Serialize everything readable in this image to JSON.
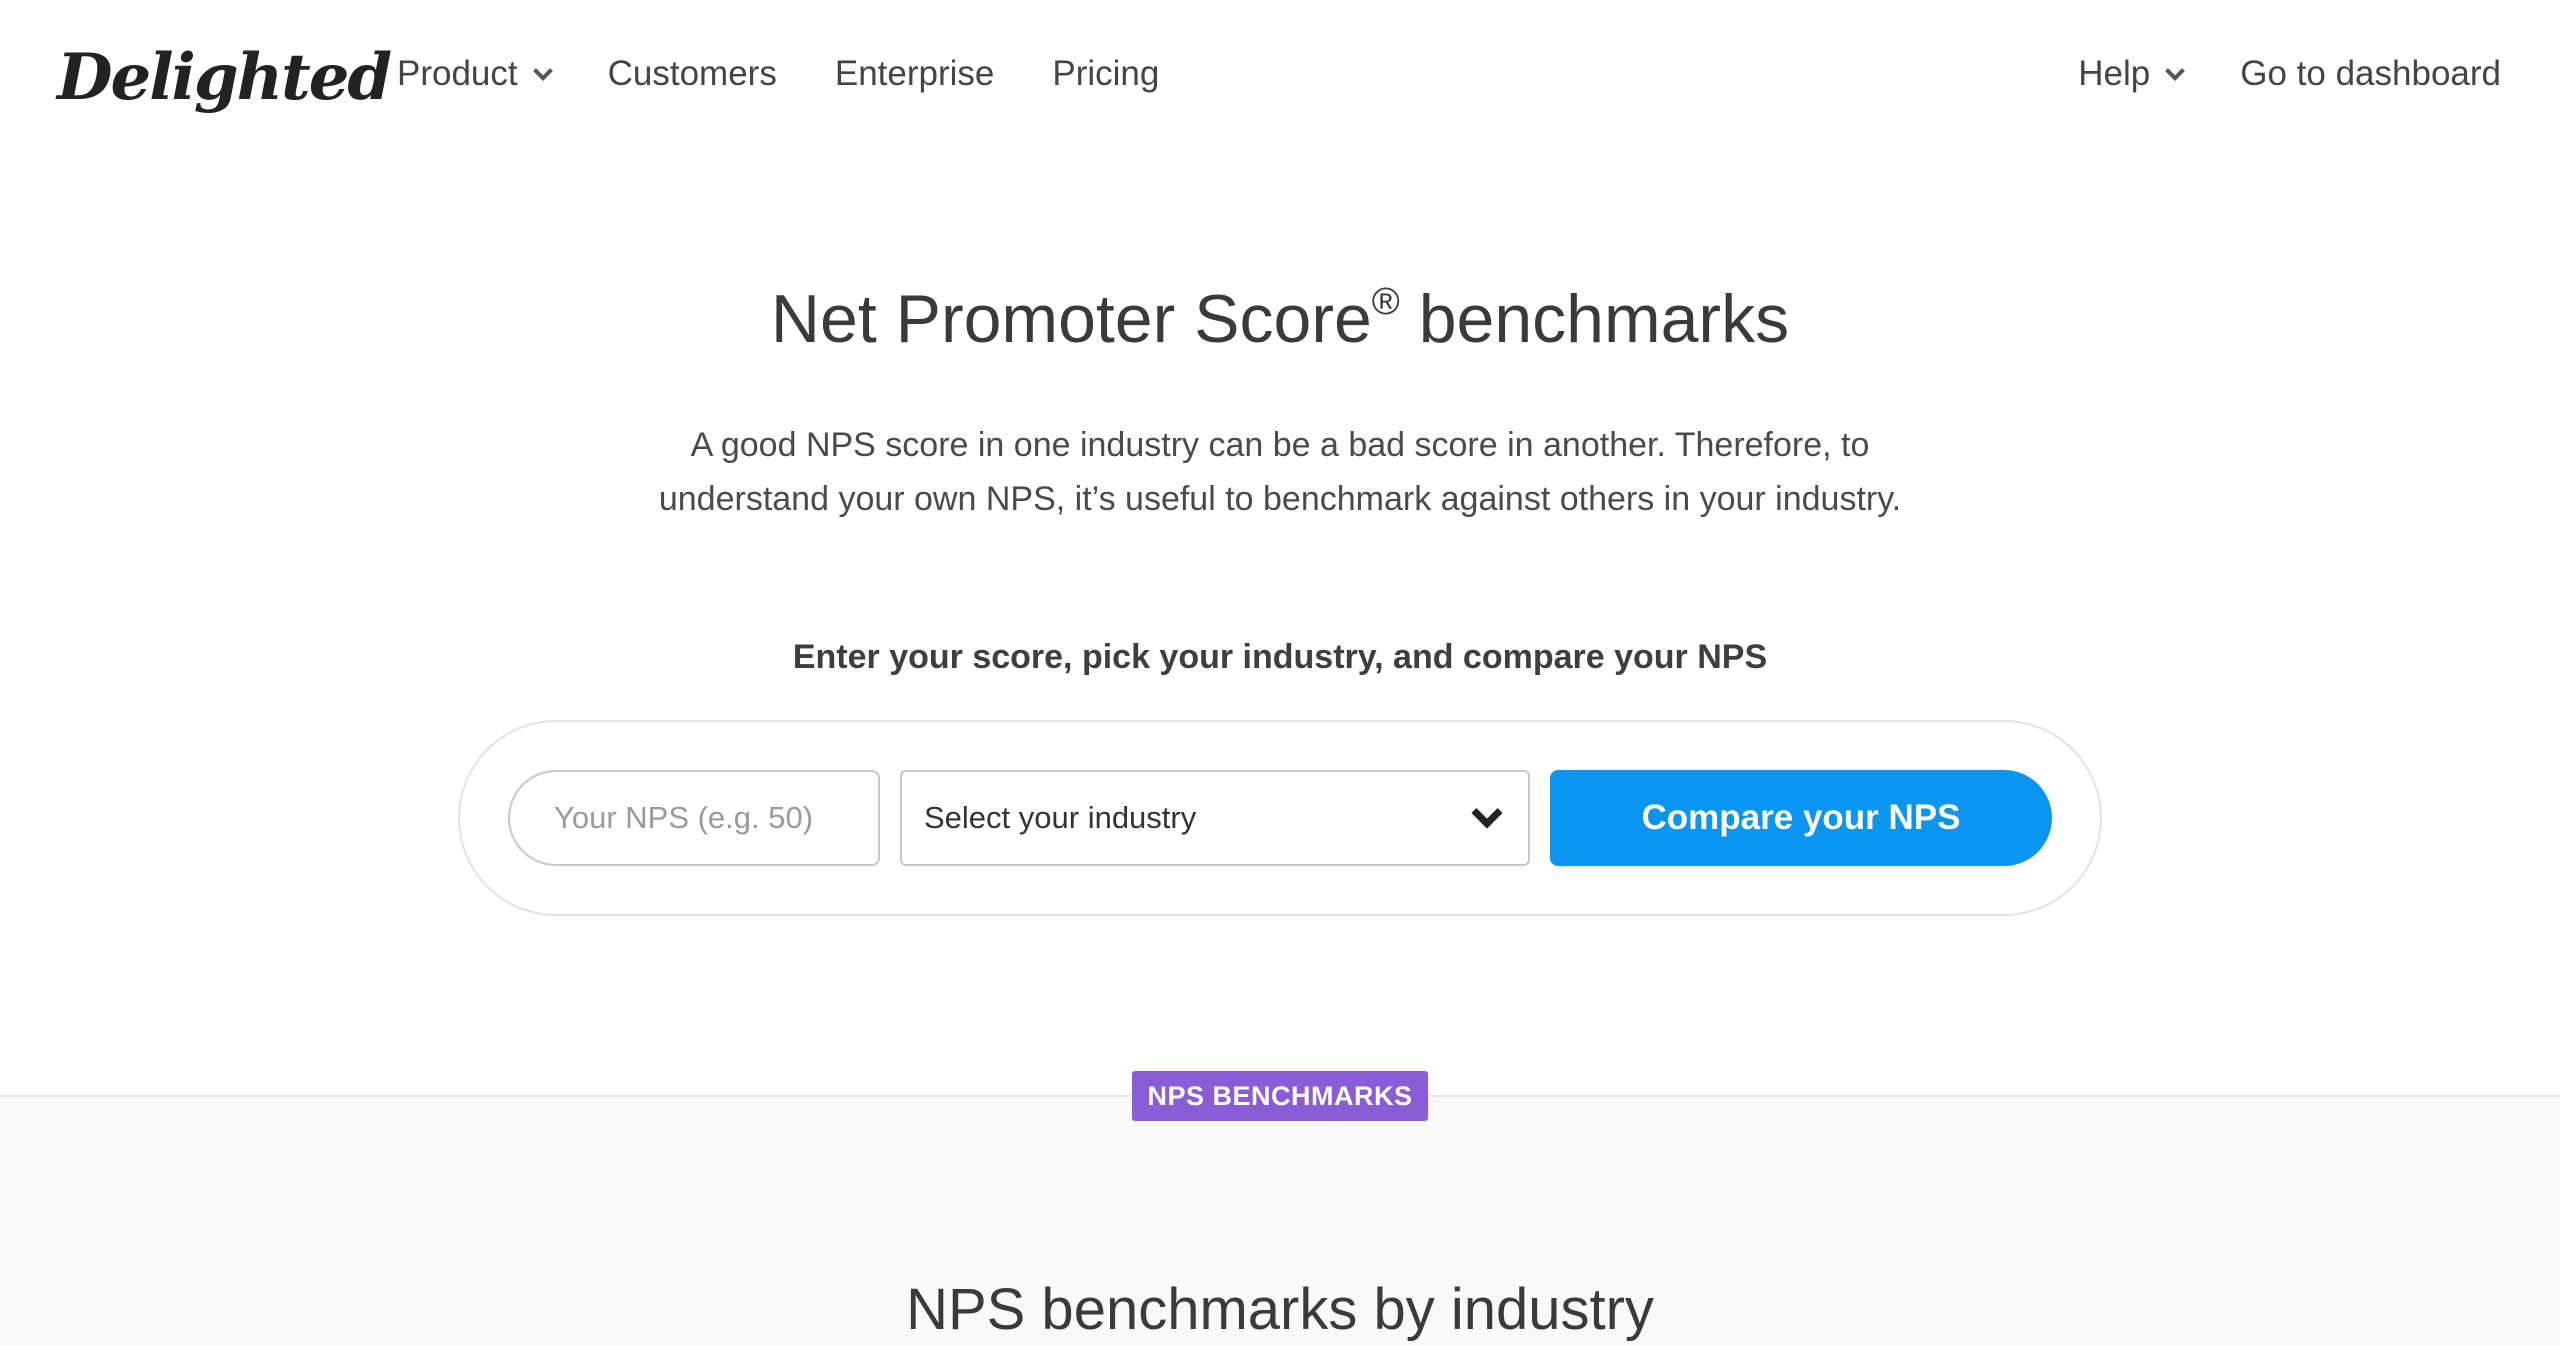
{
  "logo": {
    "text": "Delighted"
  },
  "nav": {
    "left": [
      {
        "label": "Product",
        "has_dropdown": true
      },
      {
        "label": "Customers",
        "has_dropdown": false
      },
      {
        "label": "Enterprise",
        "has_dropdown": false
      },
      {
        "label": "Pricing",
        "has_dropdown": false
      }
    ],
    "right": [
      {
        "label": "Help",
        "has_dropdown": true
      },
      {
        "label": "Go to dashboard",
        "has_dropdown": false
      }
    ]
  },
  "hero": {
    "title": "Net Promoter Score",
    "title_mark": "®",
    "title_rest": " benchmarks",
    "subtitle": "A good NPS score in one industry can be a bad score in another. Therefore, to understand your own NPS, it’s useful to benchmark against others in your industry."
  },
  "compare": {
    "label": "Enter your score, pick your industry, and compare your NPS",
    "nps_placeholder": "Your NPS (e.g. 50)",
    "nps_value": "",
    "industry_selected": "Select your industry",
    "button_label": "Compare your NPS"
  },
  "benchmarks": {
    "badge": "NPS BENCHMARKS",
    "title": "NPS benchmarks by industry"
  },
  "colors": {
    "accent_blue": "#0a95f0",
    "badge_purple": "#8a5cd6",
    "text_dark": "#3a3a3a",
    "section_bg": "#f9f9f9"
  }
}
